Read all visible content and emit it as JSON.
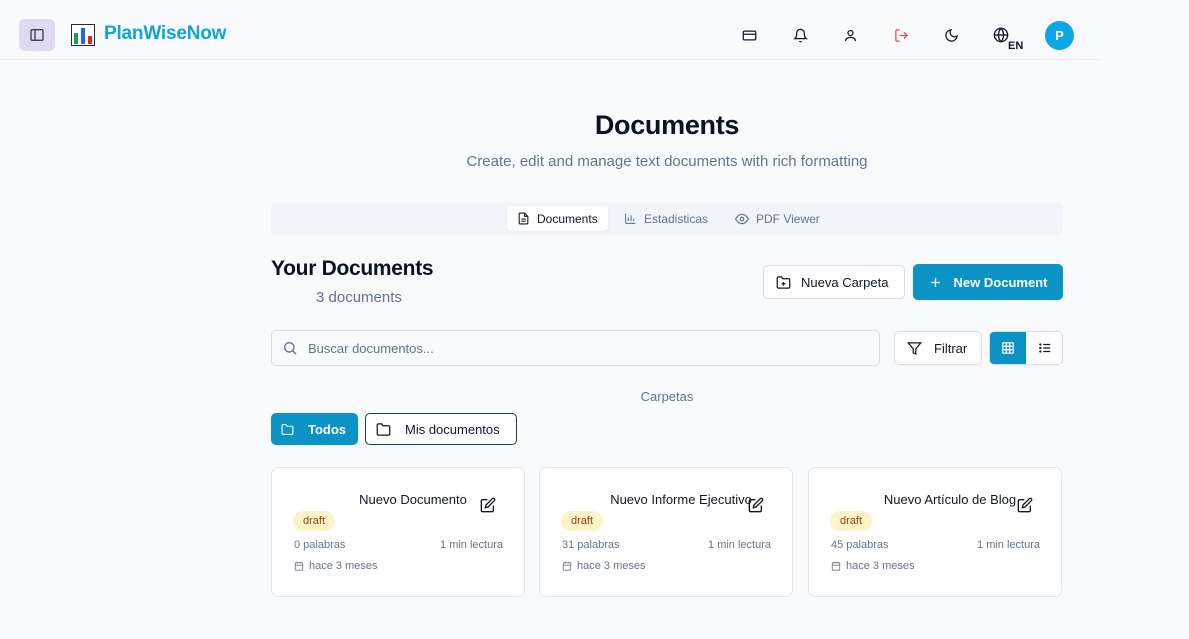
{
  "header": {
    "brand": "PlanWiseNow",
    "lang_code": "EN",
    "avatar_initial": "P",
    "icons": [
      "sidebar-toggle-icon",
      "chart-logo-icon",
      "credit-card-icon",
      "bell-icon",
      "user-icon",
      "logout-icon",
      "moon-icon",
      "globe-icon"
    ]
  },
  "page": {
    "title": "Documents",
    "subtitle": "Create, edit and manage text documents with rich formatting"
  },
  "tabs": [
    {
      "label": "Documents",
      "icon": "file-text-icon",
      "active": true
    },
    {
      "label": "Estadisticas",
      "icon": "bar-chart-icon",
      "active": false
    },
    {
      "label": "PDF Viewer",
      "icon": "eye-icon",
      "active": false
    }
  ],
  "section": {
    "title": "Your Documents",
    "count": "3 documents",
    "new_folder_label": "Nueva Carpeta",
    "new_document_label": "New Document"
  },
  "search": {
    "placeholder": "Buscar documentos...",
    "value": ""
  },
  "filter_label": "Filtrar",
  "view_mode": "grid",
  "folders": {
    "heading": "Carpetas",
    "items": [
      {
        "label": "Todos",
        "active": true
      },
      {
        "label": "Mis documentos",
        "active": false
      }
    ]
  },
  "documents": [
    {
      "title": "Nuevo Documento",
      "status": "draft",
      "words": "0 palabras",
      "read_time": "1 min lectura",
      "date": "hace 3 meses"
    },
    {
      "title": "Nuevo Informe Ejecutivo",
      "status": "draft",
      "words": "31 palabras",
      "read_time": "1 min lectura",
      "date": "hace 3 meses"
    },
    {
      "title": "Nuevo Artículo de Blog",
      "status": "draft",
      "words": "45 palabras",
      "read_time": "1 min lectura",
      "date": "hace 3 meses"
    }
  ],
  "colors": {
    "primary": "#0b93c6",
    "brand": "#0ea5d8",
    "draft_badge_bg": "#fef3c7",
    "logout_icon": "#ef4444"
  }
}
